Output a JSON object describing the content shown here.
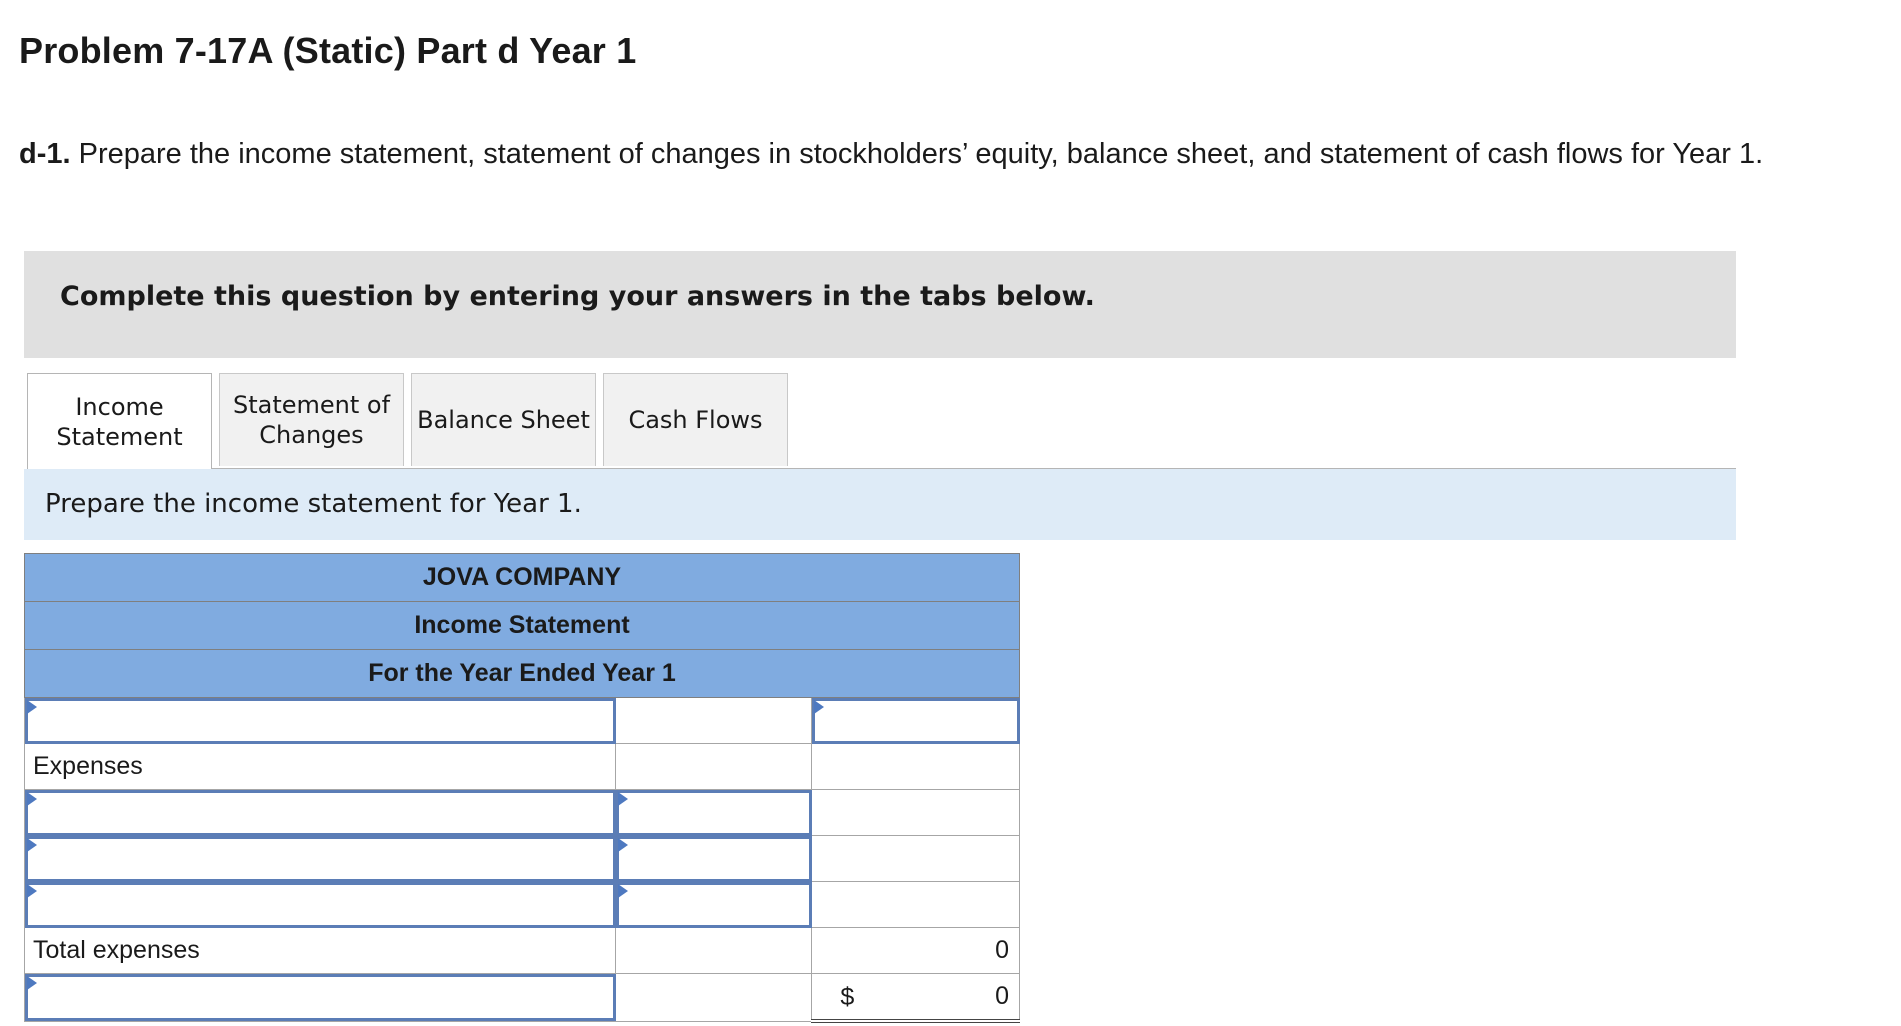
{
  "page": {
    "title": "Problem 7-17A (Static) Part d Year 1",
    "instruction_prefix": "d-1.",
    "instruction_text": " Prepare the income statement, statement of changes in stockholders’ equity, balance sheet, and statement of cash flows for Year 1."
  },
  "banner": {
    "text": "Complete this question by entering your answers in the tabs below."
  },
  "tabs": [
    {
      "label": "Income\nStatement",
      "active": true
    },
    {
      "label": "Statement of\nChanges",
      "active": false
    },
    {
      "label": "Balance Sheet",
      "active": false
    },
    {
      "label": "Cash Flows",
      "active": false
    }
  ],
  "prompt": {
    "text": "Prepare the income statement for Year 1."
  },
  "statement": {
    "company": "JOVA COMPANY",
    "name": "Income Statement",
    "period": "For the Year Ended Year 1",
    "expenses_label": "Expenses",
    "total_expenses_label": "Total expenses",
    "total_expenses_value": "0",
    "net_currency": "$",
    "net_value": "0"
  },
  "colors": {
    "header_blue": "#80abe0",
    "prompt_blue": "#deebf7",
    "input_border": "#5b7db6"
  }
}
